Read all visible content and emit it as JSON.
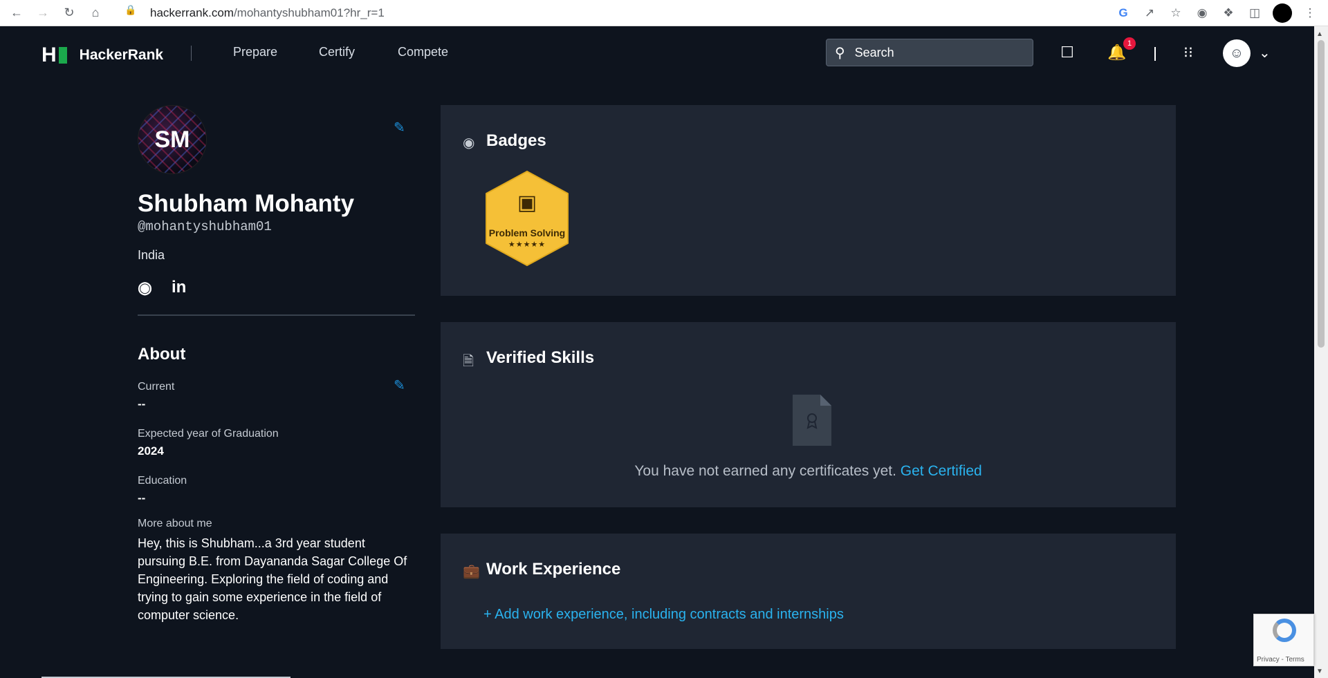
{
  "browser": {
    "url_host": "hackerrank.com",
    "url_path": "/mohantyshubham01?hr_r=1"
  },
  "nav": {
    "brand": "HackerRank",
    "logo_letter": "H",
    "links": [
      "Prepare",
      "Certify",
      "Compete"
    ],
    "search_placeholder": "Search",
    "notification_count": "1"
  },
  "profile": {
    "initials": "SM",
    "name": "Shubham Mohanty",
    "handle": "@mohantyshubham01",
    "country": "India",
    "linkedin_label": "in"
  },
  "about": {
    "title": "About",
    "current_label": "Current",
    "current_value": "--",
    "graduation_label": "Expected year of Graduation",
    "graduation_value": "2024",
    "education_label": "Education",
    "education_value": "--",
    "more_label": "More about me",
    "more_text": "Hey, this is Shubham...a 3rd year student pursuing B.E. from Dayananda Sagar College Of Engineering. Exploring the field of coding and trying to gain some experience in the field of computer science."
  },
  "badges": {
    "title": "Badges",
    "items": [
      {
        "label": "Problem Solving",
        "stars": "★★★★★",
        "stars_count": 5,
        "color": "#f5c037"
      }
    ]
  },
  "verified_skills": {
    "title": "Verified Skills",
    "empty_text": "You have not earned any certificates yet.",
    "link": "Get Certified"
  },
  "work_experience": {
    "title": "Work Experience",
    "add_link": "+ Add work experience, including contracts and internships"
  },
  "recaptcha": {
    "footer": "Privacy - Terms"
  },
  "colors": {
    "bg": "#0e141e",
    "panel": "#1f2633",
    "accent_green": "#1ba94c",
    "link_blue": "#2ab3ef",
    "badge_gold": "#f5c037"
  }
}
